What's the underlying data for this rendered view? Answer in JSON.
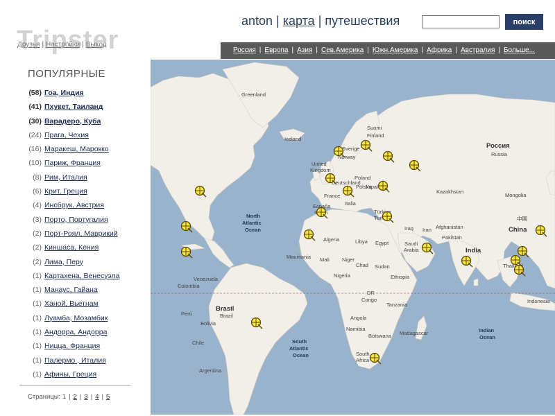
{
  "header": {
    "logo": "Tripster",
    "user_links": [
      "Друзья",
      "Настройки",
      "Выход"
    ]
  },
  "topnav": {
    "user": "anton",
    "map": "карта",
    "trips": "путешествия"
  },
  "search": {
    "value": "",
    "button": "поиск"
  },
  "regions": [
    "Россия",
    "Европа",
    "Азия",
    "Сев.Америка",
    "Южн.Америка",
    "Африка",
    "Австралия",
    "Больше..."
  ],
  "sidebar": {
    "title": "ПОПУЛЯРНЫЕ",
    "items": [
      {
        "count": "(58)",
        "label": "Гоа, Индия",
        "bold": true
      },
      {
        "count": "(41)",
        "label": "Пхукет, Таиланд",
        "bold": true
      },
      {
        "count": "(30)",
        "label": "Варадеро, Куба",
        "bold": true
      },
      {
        "count": "(24)",
        "label": "Прага, Чехия",
        "bold": false
      },
      {
        "count": "(16)",
        "label": "Маракеш, Марокко",
        "bold": false
      },
      {
        "count": "(10)",
        "label": "Париж, Франция",
        "bold": false
      },
      {
        "count": "(8)",
        "label": "Рим, Италия",
        "bold": false
      },
      {
        "count": "(6)",
        "label": "Крит, Греция",
        "bold": false
      },
      {
        "count": "(4)",
        "label": "Инсбрук, Австрия",
        "bold": false
      },
      {
        "count": "(3)",
        "label": "Порто, Португалия",
        "bold": false
      },
      {
        "count": "(2)",
        "label": "Порт-Роял, Маврикий",
        "bold": false
      },
      {
        "count": "(2)",
        "label": "Киншаса, Кения",
        "bold": false
      },
      {
        "count": "(2)",
        "label": "Лима, Перу",
        "bold": false
      },
      {
        "count": "(1)",
        "label": "Картахена, Венесуэла",
        "bold": false
      },
      {
        "count": "(1)",
        "label": "Манаус, Гайана",
        "bold": false
      },
      {
        "count": "(1)",
        "label": "Ханой, Вьетнам",
        "bold": false
      },
      {
        "count": "(1)",
        "label": "Луамба, Мозамбик",
        "bold": false
      },
      {
        "count": "(1)",
        "label": "Андорра, Андорра",
        "bold": false
      },
      {
        "count": "(1)",
        "label": "Ницца, Франция",
        "bold": false
      },
      {
        "count": "(1)",
        "label": "Палермо , Италия",
        "bold": false
      },
      {
        "count": "(1)",
        "label": "Афины, Греция",
        "bold": false
      }
    ]
  },
  "pagination": {
    "label": "Страницы:",
    "current": "1",
    "pages": [
      "2",
      "3",
      "4",
      "5"
    ]
  },
  "map": {
    "colors": {
      "ocean": "#99b3cc",
      "land": "#f2efe9",
      "border": "#c9a7c3",
      "marker": "#f7e34a"
    },
    "labels": [
      {
        "id": "greenland",
        "text": "Greenland",
        "cls": "ml"
      },
      {
        "id": "iceland",
        "text": "Iceland",
        "cls": "ml"
      },
      {
        "id": "sweden",
        "text": "Sverige",
        "cls": "ml"
      },
      {
        "id": "suomi",
        "text": "Suomi",
        "cls": "ml"
      },
      {
        "id": "finland",
        "text": "Finland",
        "cls": "ml"
      },
      {
        "id": "norway",
        "text": "Norway",
        "cls": "ml"
      },
      {
        "id": "uk",
        "text": "United",
        "cls": "ml"
      },
      {
        "id": "uk2",
        "text": "Kingdom",
        "cls": "ml"
      },
      {
        "id": "deutschland",
        "text": "Deutschland",
        "cls": "ml"
      },
      {
        "id": "poland",
        "text": "Poland",
        "cls": "ml"
      },
      {
        "id": "polska",
        "text": "Polska",
        "cls": "ml"
      },
      {
        "id": "ukraina",
        "text": "Україна",
        "cls": "ml"
      },
      {
        "id": "france",
        "text": "France",
        "cls": "ml"
      },
      {
        "id": "espana",
        "text": "España",
        "cls": "ml"
      },
      {
        "id": "spain",
        "text": "Spain",
        "cls": "ml"
      },
      {
        "id": "italia",
        "text": "Italia",
        "cls": "ml"
      },
      {
        "id": "turkiye",
        "text": "Türkiye",
        "cls": "ml"
      },
      {
        "id": "turkey",
        "text": "Turkey",
        "cls": "ml"
      },
      {
        "id": "rossiya",
        "text": "Россия",
        "cls": "ml-big"
      },
      {
        "id": "russia",
        "text": "Russia",
        "cls": "ml"
      },
      {
        "id": "kazakhstan",
        "text": "Kazakhstan",
        "cls": "ml"
      },
      {
        "id": "mongolia",
        "text": "Mongolia",
        "cls": "ml"
      },
      {
        "id": "afghanistan",
        "text": "Afghanistan",
        "cls": "ml"
      },
      {
        "id": "iran",
        "text": "Iran",
        "cls": "ml"
      },
      {
        "id": "iraq",
        "text": "Iraq",
        "cls": "ml"
      },
      {
        "id": "pakistan",
        "text": "Pakistan",
        "cls": "ml"
      },
      {
        "id": "china",
        "text": "China",
        "cls": "ml-big"
      },
      {
        "id": "china_zh",
        "text": "中国",
        "cls": "ml"
      },
      {
        "id": "india",
        "text": "India",
        "cls": "ml-big"
      },
      {
        "id": "saudi",
        "text": "Saudi",
        "cls": "ml"
      },
      {
        "id": "arabia",
        "text": "Arabia",
        "cls": "ml"
      },
      {
        "id": "thailand",
        "text": "Thailand",
        "cls": "ml"
      },
      {
        "id": "indonesia",
        "text": "Indonesia",
        "cls": "ml"
      },
      {
        "id": "algeria",
        "text": "Algeria",
        "cls": "ml"
      },
      {
        "id": "libya",
        "text": "Libya",
        "cls": "ml"
      },
      {
        "id": "egypt",
        "text": "Egypt",
        "cls": "ml"
      },
      {
        "id": "mauritania",
        "text": "Mauritania",
        "cls": "ml"
      },
      {
        "id": "mali",
        "text": "Mali",
        "cls": "ml"
      },
      {
        "id": "niger",
        "text": "Niger",
        "cls": "ml"
      },
      {
        "id": "chad",
        "text": "Chad",
        "cls": "ml"
      },
      {
        "id": "sudan",
        "text": "Sudan",
        "cls": "ml"
      },
      {
        "id": "nigeria",
        "text": "Nigeria",
        "cls": "ml"
      },
      {
        "id": "ethiopia",
        "text": "Ethiopia",
        "cls": "ml"
      },
      {
        "id": "drc",
        "text": "DR",
        "cls": "ml"
      },
      {
        "id": "congo",
        "text": "Congo",
        "cls": "ml"
      },
      {
        "id": "tanzania",
        "text": "Tanzania",
        "cls": "ml"
      },
      {
        "id": "angola",
        "text": "Angola",
        "cls": "ml"
      },
      {
        "id": "namibia",
        "text": "Namibia",
        "cls": "ml"
      },
      {
        "id": "botswana",
        "text": "Botswana",
        "cls": "ml"
      },
      {
        "id": "madagascar",
        "text": "Madagascar",
        "cls": "ml"
      },
      {
        "id": "southafrica",
        "text": "South",
        "cls": "ml"
      },
      {
        "id": "southafrica2",
        "text": "Africa",
        "cls": "ml"
      },
      {
        "id": "venezuela",
        "text": "Venezuela",
        "cls": "ml"
      },
      {
        "id": "colombia",
        "text": "Colombia",
        "cls": "ml"
      },
      {
        "id": "peru",
        "text": "Perú",
        "cls": "ml"
      },
      {
        "id": "bolivia",
        "text": "Bolivia",
        "cls": "ml"
      },
      {
        "id": "brasil",
        "text": "Brasil",
        "cls": "ml-big"
      },
      {
        "id": "brazil",
        "text": "Brazil",
        "cls": "ml"
      },
      {
        "id": "chile",
        "text": "Chile",
        "cls": "ml"
      },
      {
        "id": "argentina",
        "text": "Argentina",
        "cls": "ml"
      },
      {
        "id": "nao1",
        "text": "North",
        "cls": "ml-sea"
      },
      {
        "id": "nao2",
        "text": "Atlantic",
        "cls": "ml-sea"
      },
      {
        "id": "nao3",
        "text": "Ocean",
        "cls": "ml-sea"
      },
      {
        "id": "sao1",
        "text": "South",
        "cls": "ml-sea"
      },
      {
        "id": "sao2",
        "text": "Atlantic",
        "cls": "ml-sea"
      },
      {
        "id": "sao3",
        "text": "Ocean",
        "cls": "ml-sea"
      },
      {
        "id": "io1",
        "text": "Indian",
        "cls": "ml-sea"
      },
      {
        "id": "io2",
        "text": "Ocean",
        "cls": "ml-sea"
      }
    ]
  }
}
